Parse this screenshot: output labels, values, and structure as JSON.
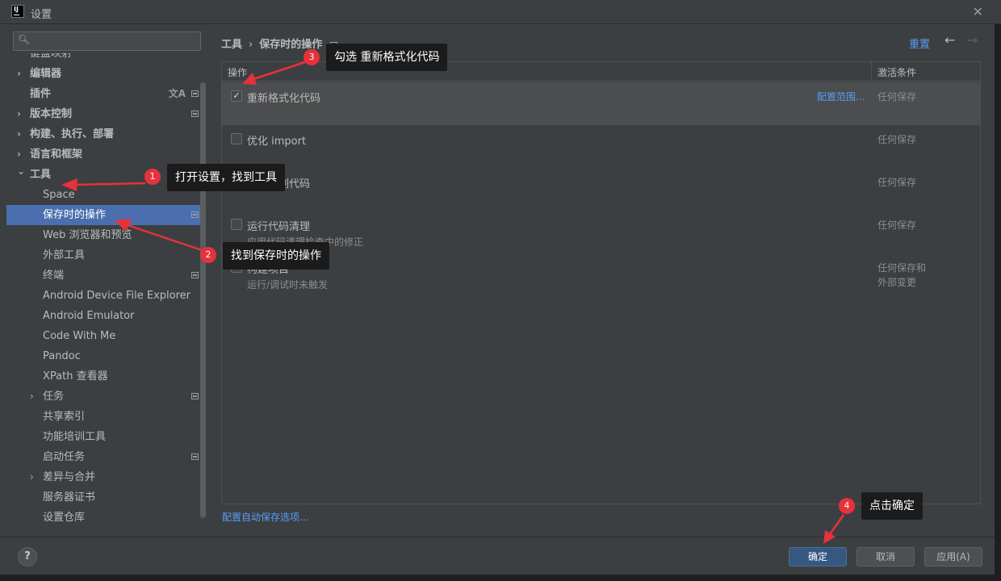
{
  "window": {
    "title": "设置",
    "close_glyph": "✕",
    "app_icon_text": "IJ"
  },
  "search": {
    "placeholder": "",
    "icon": "search-icon"
  },
  "sidebar": {
    "items": [
      {
        "label": "键盘映射",
        "bold": false
      },
      {
        "label": "编辑器",
        "bold": true,
        "expandable": true
      },
      {
        "label": "插件",
        "bold": true,
        "translate_icon": true,
        "settings_icon": true
      },
      {
        "label": "版本控制",
        "bold": true,
        "expandable": true,
        "settings_icon": true
      },
      {
        "label": "构建、执行、部署",
        "bold": true,
        "expandable": true
      },
      {
        "label": "语言和框架",
        "bold": true,
        "expandable": true
      },
      {
        "label": "工具",
        "bold": true,
        "expanded": true
      },
      {
        "label": "Space"
      },
      {
        "label": "保存时的操作",
        "selected": true,
        "settings_icon": true
      },
      {
        "label": "Web 浏览器和预览"
      },
      {
        "label": "外部工具"
      },
      {
        "label": "终端",
        "settings_icon": true
      },
      {
        "label": "Android Device File Explorer"
      },
      {
        "label": "Android Emulator"
      },
      {
        "label": "Code With Me"
      },
      {
        "label": "Pandoc"
      },
      {
        "label": "XPath 查看器"
      },
      {
        "label": "任务",
        "expandable": true,
        "settings_icon": true
      },
      {
        "label": "共享索引"
      },
      {
        "label": "功能培训工具"
      },
      {
        "label": "启动任务",
        "settings_icon": true
      },
      {
        "label": "差异与合并",
        "expandable": true
      },
      {
        "label": "服务器证书"
      },
      {
        "label": "设置仓库"
      }
    ]
  },
  "main": {
    "breadcrumb": {
      "parent": "工具",
      "separator": "›",
      "current": "保存时的操作"
    },
    "reset_label": "重置",
    "nav_back": "←",
    "nav_forward": "→",
    "table": {
      "col_action": "操作",
      "col_condition": "激活条件",
      "rows": [
        {
          "title": "重新格式化代码",
          "subtitle": "",
          "checked": true,
          "condition": "任何保存",
          "link": "配置范围..."
        },
        {
          "title": "优化 import",
          "subtitle": "",
          "checked": false,
          "condition": "任何保存",
          "link": ""
        },
        {
          "title": "重新排列代码",
          "subtitle": "",
          "checked": false,
          "condition": "任何保存",
          "link": ""
        },
        {
          "title": "运行代码清理",
          "subtitle": "应用代码清理检查中的修正",
          "checked": false,
          "condition": "任何保存",
          "link": ""
        },
        {
          "title": "构建项目",
          "subtitle": "运行/调试时未触发",
          "checked": false,
          "condition": "任何保存和\n外部变更",
          "link": ""
        }
      ]
    },
    "bottom_link": "配置自动保存选项..."
  },
  "footer": {
    "help": "?",
    "ok": "确定",
    "cancel": "取消",
    "apply": "应用(A)"
  },
  "annotations": [
    {
      "badge": "1",
      "text": "打开设置，找到工具"
    },
    {
      "badge": "2",
      "text": "找到保存时的操作"
    },
    {
      "badge": "3",
      "text": "勾选 重新格式化代码"
    },
    {
      "badge": "4",
      "text": "点击确定"
    }
  ],
  "colors": {
    "accent": "#4b6eaf",
    "link": "#589df6",
    "annotation_red": "#e7313b",
    "annotation_bg": "#1b1b1b"
  }
}
